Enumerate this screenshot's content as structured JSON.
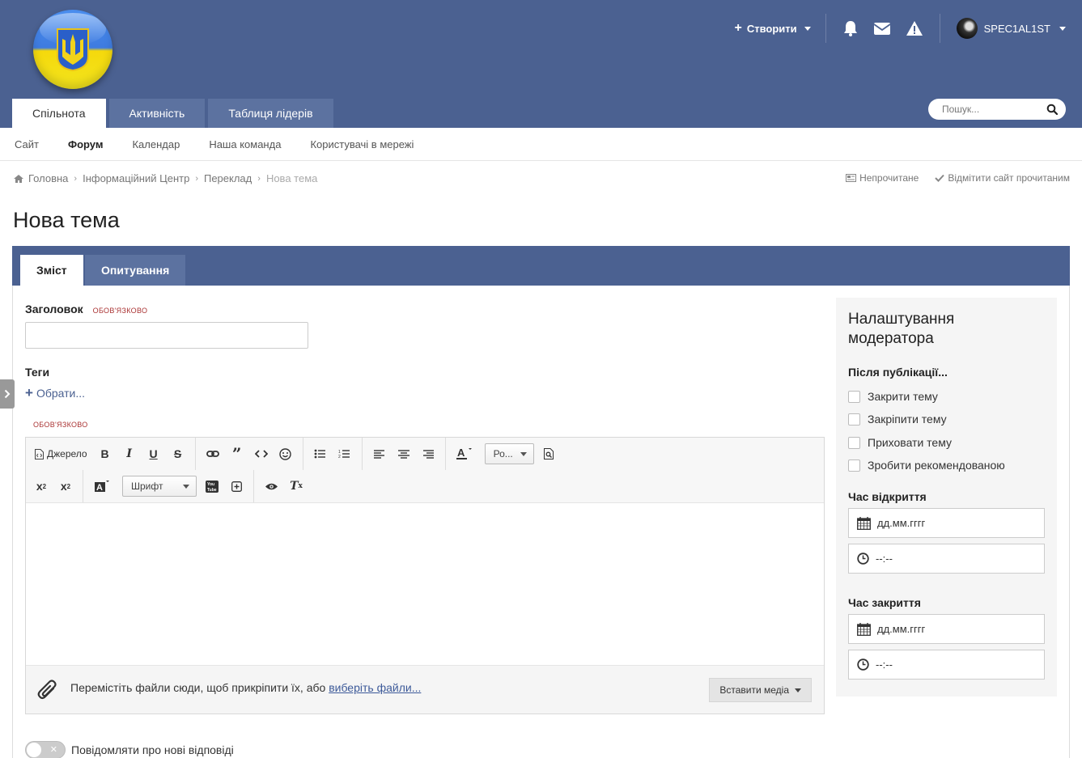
{
  "header": {
    "create_label": "Створити",
    "username": "SPEC1AL1ST",
    "search_placeholder": "Пошук...",
    "nav_tabs": [
      "Спільнота",
      "Активність",
      "Таблиця лідерів"
    ]
  },
  "subnav": [
    "Сайт",
    "Форум",
    "Календар",
    "Наша команда",
    "Користувачі в мережі"
  ],
  "breadcrumb": {
    "items": [
      "Головна",
      "Інформаційний Центр",
      "Переклад"
    ],
    "current": "Нова тема",
    "unread": "Непрочитане",
    "mark_read": "Відмітити сайт прочитаним"
  },
  "page_title": "Нова тема",
  "form": {
    "tabs": [
      "Зміст",
      "Опитування"
    ],
    "title_label": "Заголовок",
    "required": "ОБОВ'ЯЗКОВО",
    "tags_label": "Теги",
    "choose": "Обрати...",
    "editor": {
      "source": "Джерело",
      "format_select": "Ро...",
      "font_select": "Шрифт"
    },
    "attach_text": "Перемістіть файли сюди, щоб прикріпити їх, або",
    "attach_link": "виберіть файли...",
    "insert_media": "Вставити медіа",
    "notify": "Повідомляти про нові відповіді"
  },
  "moderator": {
    "title": "Налаштування модератора",
    "after_publish": "Після публікації...",
    "options": [
      "Закрити тему",
      "Закріпити тему",
      "Приховати тему",
      "Зробити рекомендованою"
    ],
    "open_time": "Час відкриття",
    "close_time": "Час закриття",
    "date_placeholder": "дд.мм.гггг",
    "time_placeholder": "--:--"
  },
  "colors": {
    "header": "#4b6191",
    "required": "#aa3333"
  }
}
